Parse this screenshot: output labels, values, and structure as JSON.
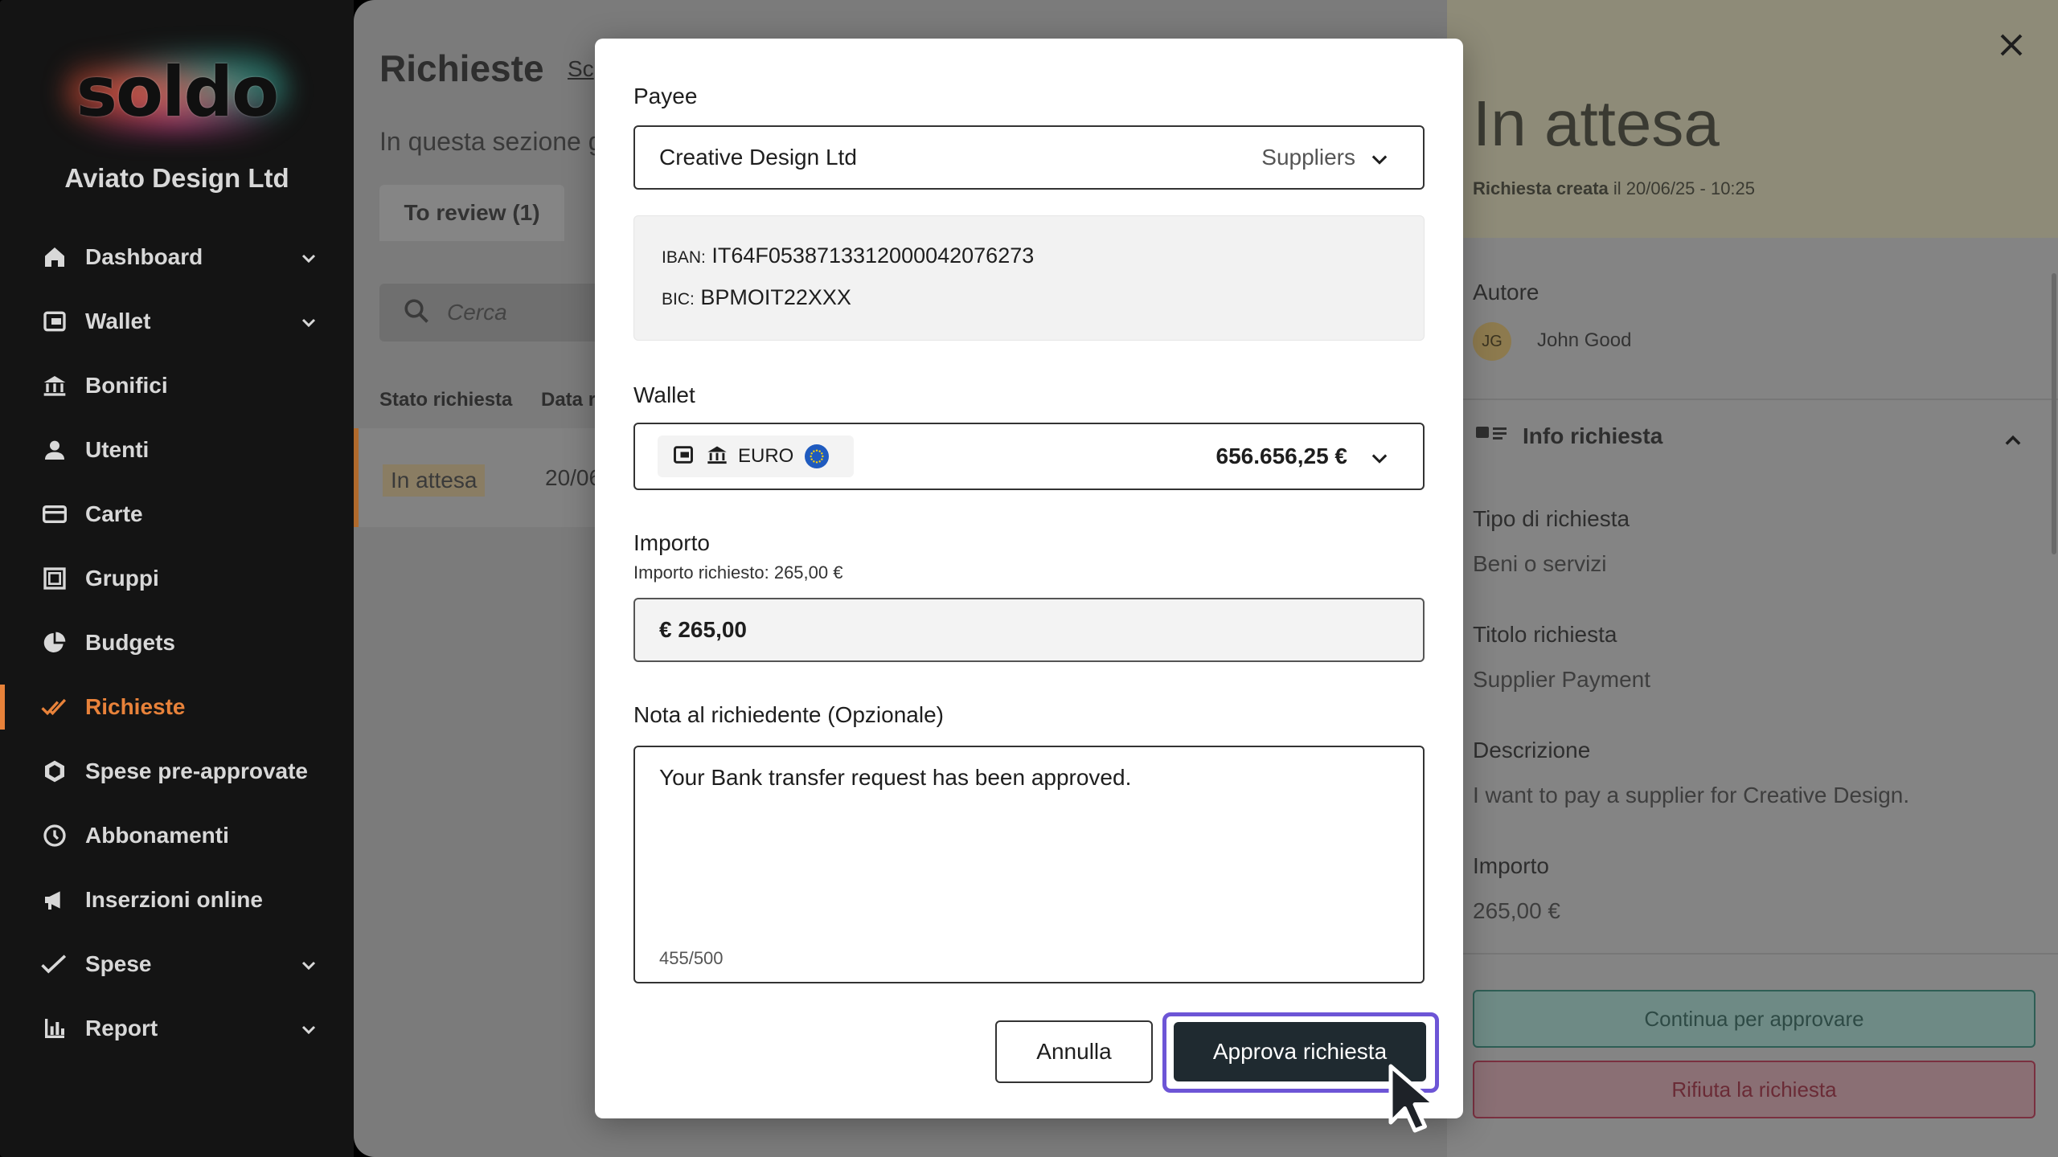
{
  "brand": {
    "logo": "soldo",
    "company": "Aviato Design Ltd"
  },
  "sidebar": {
    "items": [
      {
        "label": "Dashboard",
        "icon": "home-icon",
        "expandable": true
      },
      {
        "label": "Wallet",
        "icon": "wallet-icon",
        "expandable": true
      },
      {
        "label": "Bonifici",
        "icon": "bank-icon",
        "expandable": false
      },
      {
        "label": "Utenti",
        "icon": "user-icon",
        "expandable": false
      },
      {
        "label": "Carte",
        "icon": "cards-icon",
        "expandable": false
      },
      {
        "label": "Gruppi",
        "icon": "groups-icon",
        "expandable": false
      },
      {
        "label": "Budgets",
        "icon": "pie-icon",
        "expandable": false
      },
      {
        "label": "Richieste",
        "icon": "check-double-icon",
        "expandable": false,
        "active": true
      },
      {
        "label": "Spese pre-approvate",
        "icon": "hexagon-icon",
        "expandable": false
      },
      {
        "label": "Abbonamenti",
        "icon": "clock-icon",
        "expandable": false
      },
      {
        "label": "Inserzioni online",
        "icon": "megaphone-icon",
        "expandable": false
      },
      {
        "label": "Spese",
        "icon": "check-icon",
        "expandable": true
      },
      {
        "label": "Report",
        "icon": "bar-chart-icon",
        "expandable": true
      }
    ],
    "active_color": "#e8823a"
  },
  "main": {
    "title": "Richieste",
    "title_link": "Sc",
    "subtitle": "In questa sezione g",
    "tab": "To review (1)",
    "search_placeholder": "Cerca",
    "columns": [
      "Stato richiesta",
      "Data r"
    ],
    "row": {
      "status": "In attesa",
      "date": "20/06"
    }
  },
  "panel": {
    "status": "In attesa",
    "created_label": "Richiesta creata",
    "created_value": "il 20/06/25 - 10:25",
    "author_label": "Autore",
    "author_initials": "JG",
    "author_name": "John Good",
    "info_title": "Info richiesta",
    "fields": [
      {
        "label": "Tipo di richiesta",
        "value": "Beni o servizi"
      },
      {
        "label": "Titolo richiesta",
        "value": "Supplier Payment"
      },
      {
        "label": "Descrizione",
        "value": "I want to pay a supplier for Creative Design."
      },
      {
        "label": "Importo",
        "value": "265,00 €"
      }
    ],
    "approve_label": "Continua per approvare",
    "reject_label": "Rifiuta la richiesta"
  },
  "modal": {
    "payee_label": "Payee",
    "payee_value": "Creative Design Ltd",
    "payee_category": "Suppliers",
    "iban_label": "IBAN:",
    "iban_value": "IT64F0538713312000042076273",
    "bic_label": "BIC:",
    "bic_value": "BPMOIT22XXX",
    "wallet_label": "Wallet",
    "wallet_currency": "EURO",
    "wallet_balance": "656.656,25 €",
    "amount_label": "Importo",
    "amount_requested": "Importo richiesto: 265,00 €",
    "amount_value": "€ 265,00",
    "note_label": "Nota al richiedente  (Opzionale)",
    "note_value": "Your Bank transfer request has been approved.",
    "note_counter": "455/500",
    "cancel_label": "Annulla",
    "approve_label": "Approva richiesta",
    "focus_color": "#6d55d6"
  }
}
